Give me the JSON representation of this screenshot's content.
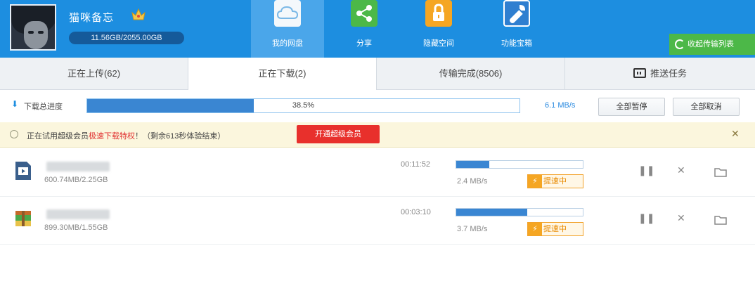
{
  "user": {
    "name": "猫咪备忘",
    "quota": "11.56GB/2055.00GB"
  },
  "nav": [
    {
      "label": "我的网盘",
      "icon": "cloud-icon",
      "active": true
    },
    {
      "label": "分享",
      "icon": "share-icon",
      "active": false
    },
    {
      "label": "隐藏空间",
      "icon": "lock-icon",
      "active": false
    },
    {
      "label": "功能宝箱",
      "icon": "wrench-icon",
      "active": false
    }
  ],
  "collapse_label": "收起传输列表",
  "tabs": [
    {
      "label": "正在上传(62)"
    },
    {
      "label": "正在下载(2)",
      "active": true
    },
    {
      "label": "传输完成(8506)"
    },
    {
      "label": "推送任务"
    }
  ],
  "progress": {
    "label": "下载总进度",
    "percent": 38.5,
    "percent_text": "38.5%",
    "speed": "6.1 MB/s",
    "pause_all": "全部暂停",
    "cancel_all": "全部取消"
  },
  "banner": {
    "text_before": "正在试用超级会员",
    "text_highlight": "极速下载特权",
    "text_after": "！（剩余613秒体验结束）",
    "vip_button": "开通超级会员",
    "close": "✕"
  },
  "downloads": [
    {
      "icon": "video-file-icon",
      "size": "600.74MB/2.25GB",
      "time_left": "00:11:52",
      "progress": 0.26,
      "speed": "2.4 MB/s",
      "boost": "提速中"
    },
    {
      "icon": "archive-file-icon",
      "size": "899.30MB/1.55GB",
      "time_left": "00:03:10",
      "progress": 0.56,
      "speed": "3.7 MB/s",
      "boost": "提速中"
    }
  ],
  "colors": {
    "topbar": "#1d8ee0",
    "accent": "#3a86d2",
    "vip": "#e8302c",
    "boost": "#f5a623",
    "collapse": "#4cb848"
  }
}
